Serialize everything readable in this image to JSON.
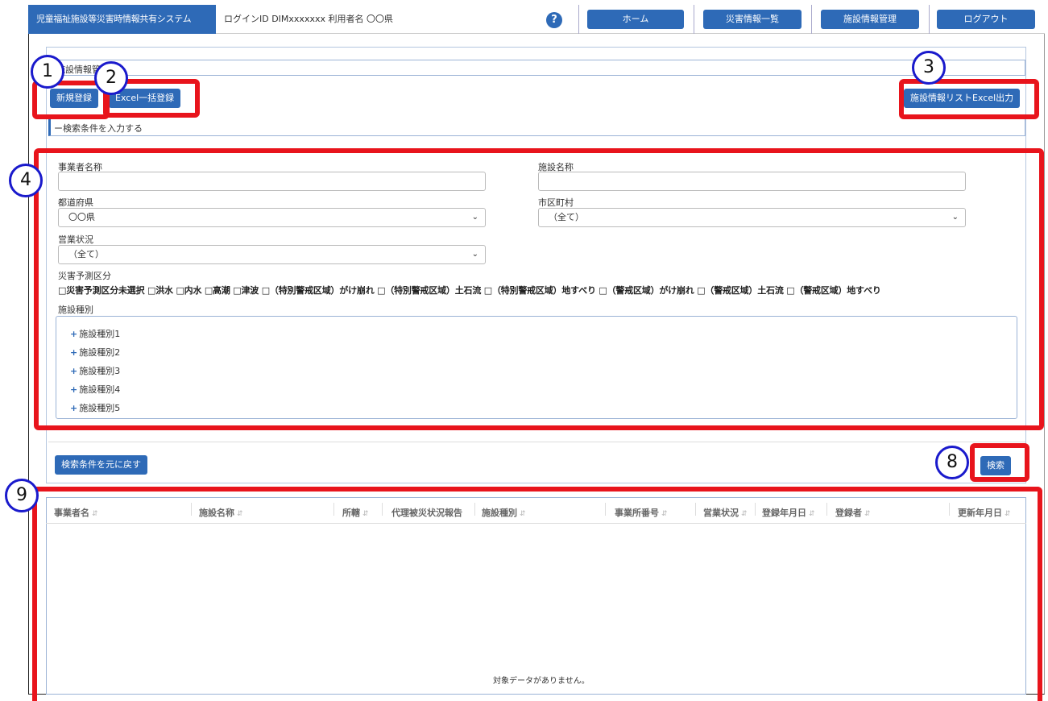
{
  "header": {
    "system_title": "児童福祉施設等災害時情報共有システム",
    "login_info": "ログインID DIMxxxxxxx 利用者名 〇〇県",
    "help_label": "?",
    "nav": {
      "home": "ホーム",
      "disaster_list": "災害情報一覧",
      "facility_mgmt": "施設情報管理",
      "logout": "ログアウト"
    }
  },
  "page": {
    "subtitle": "施設情報管理",
    "buttons": {
      "new": "新規登録",
      "excel_bulk": "Excel一括登録",
      "excel_export": "施設情報リストExcel出力",
      "reset": "検索条件を元に戻す",
      "search": "検索"
    },
    "search_toggle": "ー検索条件を入力する"
  },
  "form": {
    "operator_label": "事業者名称",
    "facility_label": "施設名称",
    "pref_label": "都道府県",
    "pref_value": "〇〇県",
    "city_label": "市区町村",
    "city_value": "（全て）",
    "status_label": "営業状況",
    "status_value": "（全て）",
    "hazard_label": "災害予測区分",
    "hazard_options": "□災害予測区分未選択 □洪水 □内水 □高潮 □津波 □（特別警戒区域）がけ崩れ □（特別警戒区域）土石流 □（特別警戒区域）地すべり □（警戒区域）がけ崩れ □（警戒区域）土石流 □（警戒区域）地すべり",
    "type_label": "施設種別",
    "types": [
      "施設種別1",
      "施設種別2",
      "施設種別3",
      "施設種別4",
      "施設種別5"
    ]
  },
  "table": {
    "columns": [
      "事業者名",
      "施設名称",
      "所轄",
      "代理被災状況報告",
      "施設種別",
      "事業所番号",
      "営業状況",
      "登録年月日",
      "登録者",
      "更新年月日"
    ],
    "empty": "対象データがありません。"
  },
  "callouts": [
    "1",
    "2",
    "3",
    "4",
    "8",
    "9"
  ],
  "colors": {
    "primary": "#2e6ab7",
    "highlight": "#e8141c",
    "callout_border": "#1a1acc"
  }
}
